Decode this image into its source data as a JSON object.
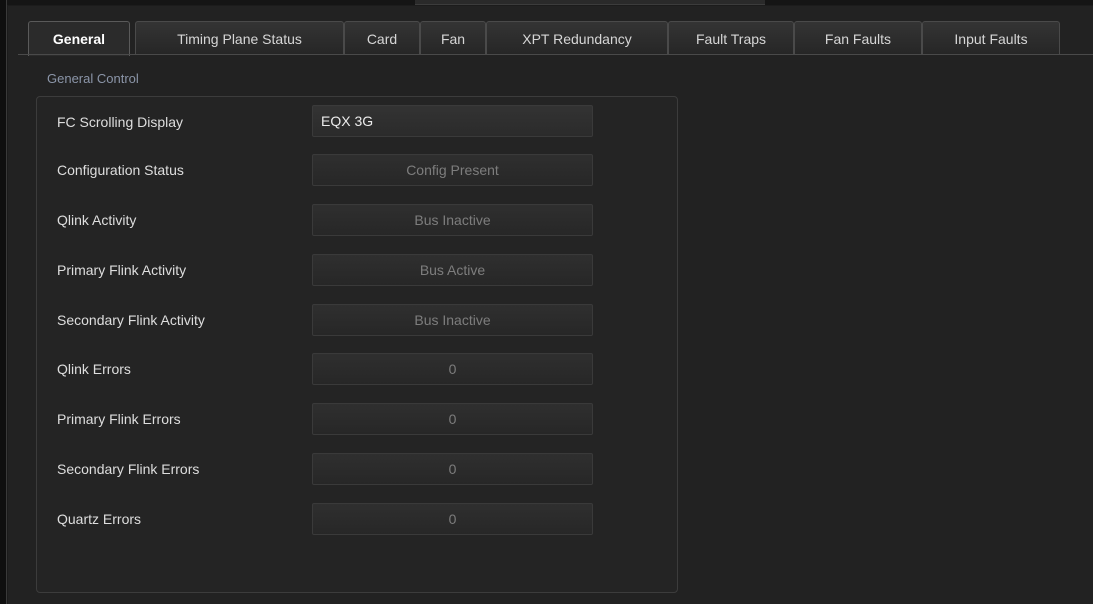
{
  "tabs": [
    {
      "label": "General",
      "active": true
    },
    {
      "label": "Timing Plane Status",
      "active": false
    },
    {
      "label": "Card",
      "active": false
    },
    {
      "label": "Fan",
      "active": false
    },
    {
      "label": "XPT Redundancy",
      "active": false
    },
    {
      "label": "Fault Traps",
      "active": false
    },
    {
      "label": "Fan Faults",
      "active": false
    },
    {
      "label": "Input Faults",
      "active": false
    }
  ],
  "section": {
    "title": "General Control"
  },
  "rows": [
    {
      "label": "FC Scrolling Display",
      "value": "EQX 3G",
      "editable": true
    },
    {
      "label": "Configuration Status",
      "value": "Config Present",
      "editable": false
    },
    {
      "label": "Qlink Activity",
      "value": "Bus Inactive",
      "editable": false
    },
    {
      "label": "Primary Flink Activity",
      "value": "Bus Active",
      "editable": false
    },
    {
      "label": "Secondary Flink Activity",
      "value": "Bus Inactive",
      "editable": false
    },
    {
      "label": "Qlink Errors",
      "value": "0",
      "editable": false
    },
    {
      "label": "Primary Flink Errors",
      "value": "0",
      "editable": false
    },
    {
      "label": "Secondary Flink Errors",
      "value": "0",
      "editable": false
    },
    {
      "label": "Quartz Errors",
      "value": "0",
      "editable": false
    }
  ],
  "colors": {
    "background": "#222222",
    "active_text": "#ffffff",
    "section_title": "#8b95a8",
    "readonly_text": "#7d7d7d"
  }
}
